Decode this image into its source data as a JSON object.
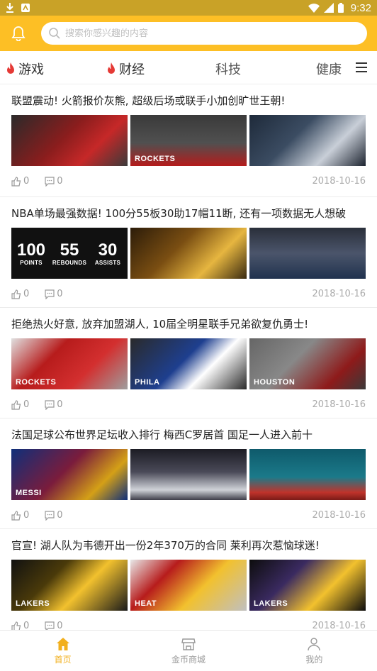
{
  "status_bar": {
    "time": "9:32",
    "icons": [
      "download-icon",
      "app-icon",
      "wifi-icon",
      "signal-icon",
      "battery-icon"
    ]
  },
  "header": {
    "search_placeholder": "搜索你感兴趣的内容",
    "icons": [
      "bell-icon",
      "search-icon"
    ]
  },
  "tabs": [
    {
      "label": "游戏",
      "hot": true
    },
    {
      "label": "财经",
      "hot": true
    },
    {
      "label": "科技",
      "hot": false
    },
    {
      "label": "健康",
      "hot": false
    }
  ],
  "articles": [
    {
      "title": "联盟震动! 火箭报价灰熊, 超级后场或联手小加创旷世王朝!",
      "likes": "0",
      "comments": "0",
      "date": "2018-10-16",
      "thumb_labels": [
        "",
        "ROCKETS",
        ""
      ]
    },
    {
      "title": "NBA单场最强数据! 100分55板30助17帽11断, 还有一项数据无人想破",
      "likes": "0",
      "comments": "0",
      "date": "2018-10-16",
      "thumb_labels": [
        "",
        "",
        ""
      ],
      "stats": [
        {
          "num": "100",
          "label": "POINTS"
        },
        {
          "num": "55",
          "label": "REBOUNDS"
        },
        {
          "num": "30",
          "label": "ASSISTS"
        }
      ]
    },
    {
      "title": "拒绝热火好意, 放弃加盟湖人, 10届全明星联手兄弟欲复仇勇士!",
      "likes": "0",
      "comments": "0",
      "date": "2018-10-16",
      "thumb_labels": [
        "ROCKETS",
        "PHILA",
        "HOUSTON"
      ]
    },
    {
      "title": "法国足球公布世界足坛收入排行 梅西C罗居首 国足一人进入前十",
      "likes": "0",
      "comments": "0",
      "date": "2018-10-16",
      "thumb_labels": [
        "MESSI",
        "",
        ""
      ]
    },
    {
      "title": "官宣! 湖人队为韦德开出一份2年370万的合同 莱利再次惹恼球迷!",
      "likes": "0",
      "comments": "0",
      "date": "2018-10-16",
      "thumb_labels": [
        "LAKERS",
        "HEAT",
        "LAKERS"
      ]
    }
  ],
  "bottom_nav": [
    {
      "label": "首页",
      "active": true,
      "icon": "home-icon"
    },
    {
      "label": "金币商城",
      "active": false,
      "icon": "store-icon"
    },
    {
      "label": "我的",
      "active": false,
      "icon": "profile-icon"
    }
  ],
  "colors": {
    "accent": "#fdbf25",
    "status_bar": "#c9a227",
    "hot_flame": "#e53935",
    "nav_active": "#f2b01e"
  }
}
